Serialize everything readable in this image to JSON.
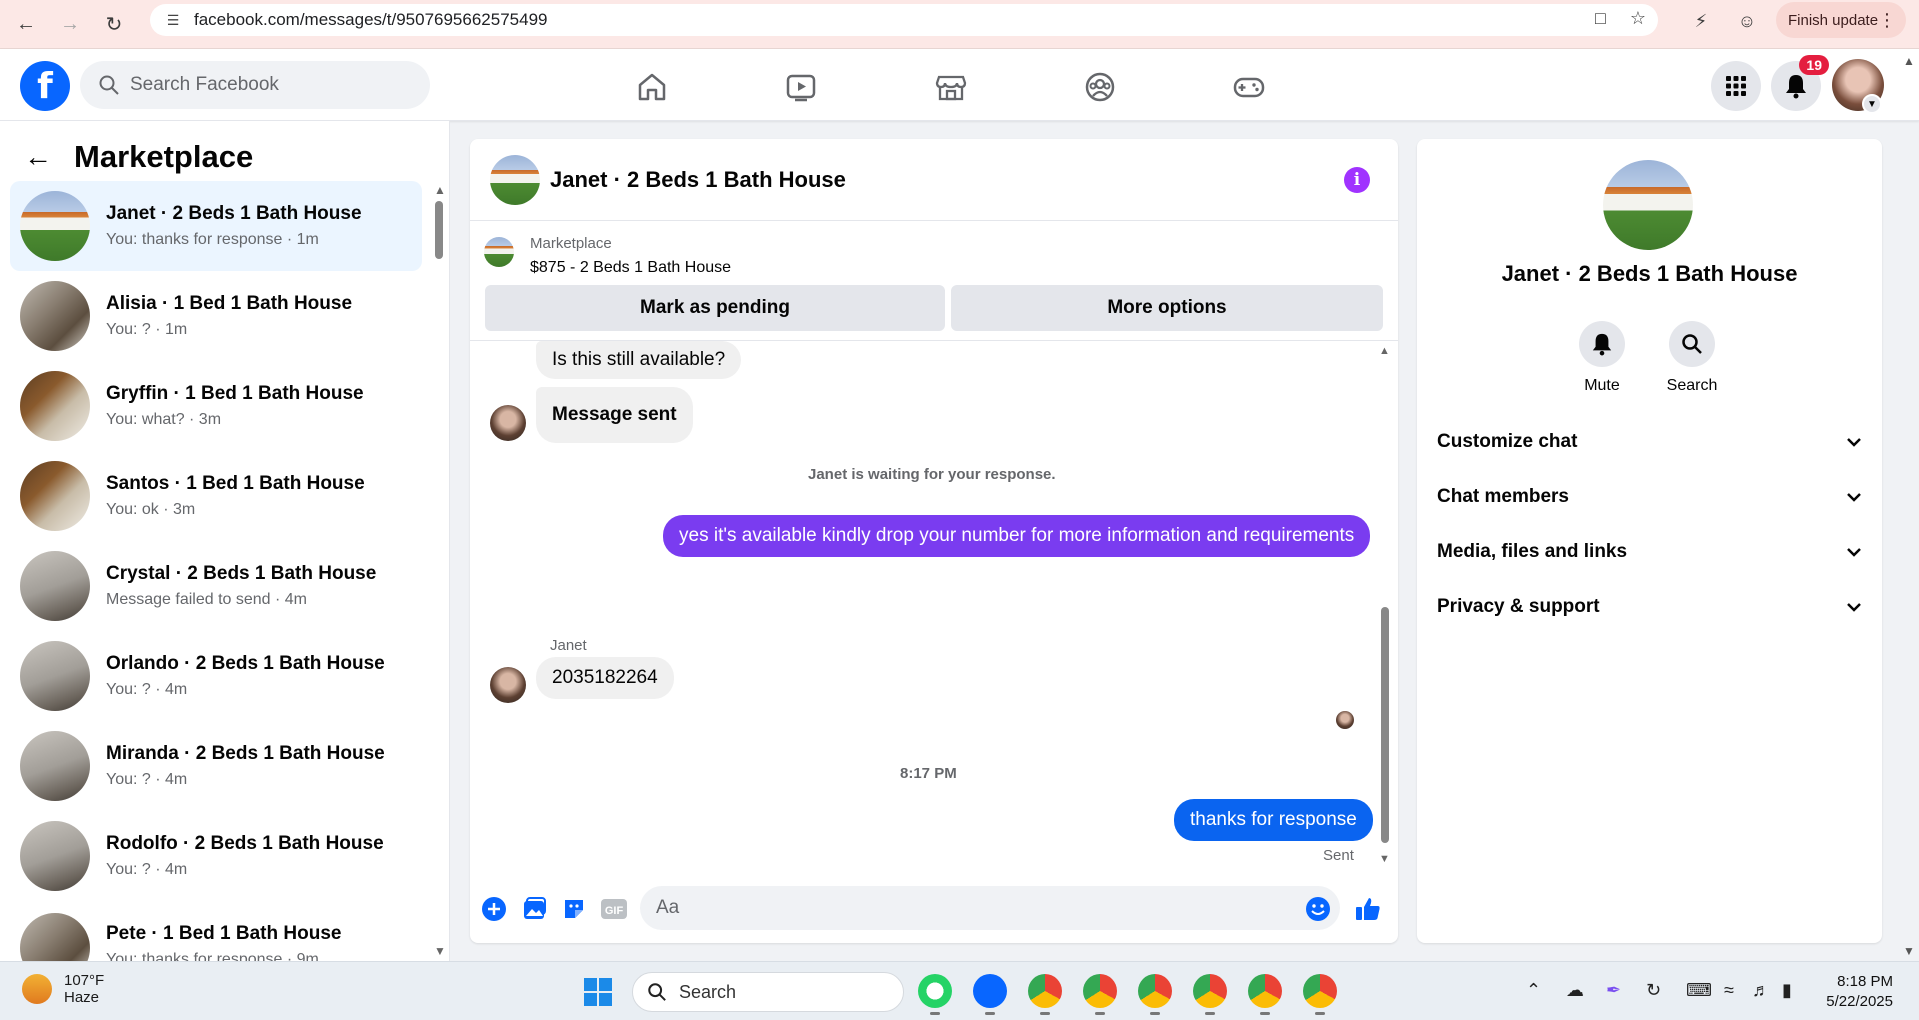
{
  "browser": {
    "url": "facebook.com/messages/t/9507695662575499",
    "finish_update": "Finish update"
  },
  "fb": {
    "search_placeholder": "Search Facebook",
    "notification_count": "19"
  },
  "sidebar": {
    "title": "Marketplace",
    "conversations": [
      {
        "name": "Janet · 2 Beds 1 Bath House",
        "preview": "You: thanks for response · 1m"
      },
      {
        "name": "Alisia · 1 Bed 1 Bath House",
        "preview": "You: ? · 1m"
      },
      {
        "name": "Gryffin · 1 Bed 1 Bath House",
        "preview": "You: what? · 3m"
      },
      {
        "name": "Santos · 1 Bed 1 Bath House",
        "preview": "You: ok · 3m"
      },
      {
        "name": "Crystal · 2 Beds 1 Bath House",
        "preview": "Message failed to send · 4m"
      },
      {
        "name": "Orlando · 2 Beds 1 Bath House",
        "preview": "You: ? · 4m"
      },
      {
        "name": "Miranda · 2 Beds 1 Bath House",
        "preview": "You: ? · 4m"
      },
      {
        "name": "Rodolfo · 2 Beds 1 Bath House",
        "preview": "You: ? · 4m"
      },
      {
        "name": "Pete · 1 Bed 1 Bath House",
        "preview": "You: thanks for response · 9m"
      }
    ]
  },
  "chat": {
    "title": "Janet · 2 Beds 1 Bath House",
    "marketplace_label": "Marketplace",
    "listing": "$875 - 2 Beds 1 Bath House",
    "mark_pending": "Mark as pending",
    "more_options": "More options",
    "messages": {
      "m1": "Is this still available?",
      "m2": "Message sent",
      "system": "Janet is waiting for your response.",
      "m3": "yes it's available kindly drop your number for more information and requirements",
      "sender": "Janet",
      "m4": "2035182264",
      "time": "8:17 PM",
      "m5": "thanks for response",
      "status": "Sent"
    },
    "composer_placeholder": "Aa",
    "colors": {
      "outgoing_purple": "#7a3cf0",
      "outgoing_blue": "#0a64f0",
      "accent": "#0866ff"
    }
  },
  "info": {
    "name": "Janet · 2 Beds 1 Bath House",
    "mute": "Mute",
    "search": "Search",
    "rows": [
      "Customize chat",
      "Chat members",
      "Media, files and links",
      "Privacy & support"
    ]
  },
  "taskbar": {
    "temp": "107°F",
    "weather": "Haze",
    "search": "Search",
    "time": "8:18 PM",
    "date": "5/22/2025"
  }
}
